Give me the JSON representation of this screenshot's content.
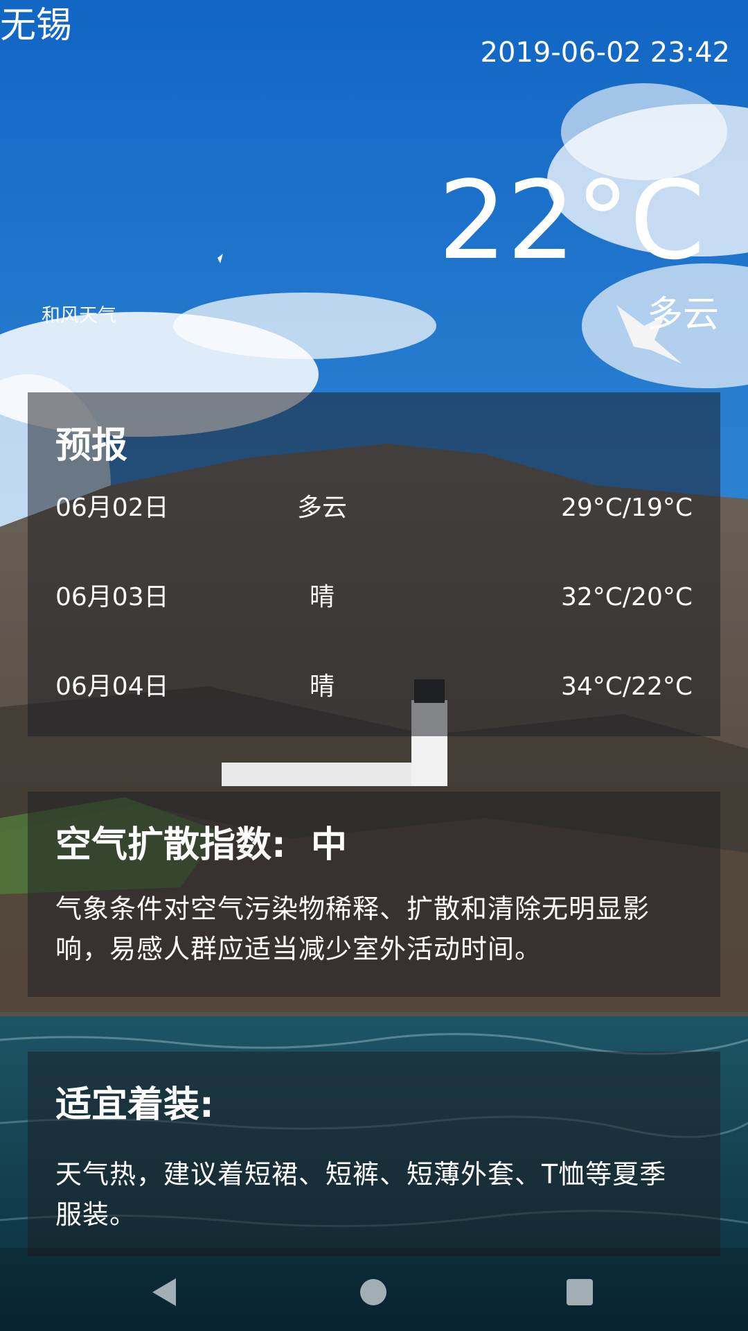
{
  "header": {
    "city": "无锡",
    "datetime": "2019-06-02 23:42",
    "temperature": "22°C",
    "condition": "多云",
    "brand": "和风天气"
  },
  "forecast": {
    "title": "预报",
    "days": [
      {
        "date": "06月02日",
        "weather": "多云",
        "temp_range": "29°C/19°C"
      },
      {
        "date": "06月03日",
        "weather": "晴",
        "temp_range": "32°C/20°C"
      },
      {
        "date": "06月04日",
        "weather": "晴",
        "temp_range": "34°C/22°C"
      }
    ]
  },
  "air": {
    "title": "空气扩散指数:  中",
    "desc": "气象条件对空气污染物稀释、扩散和清除无明显影响，易感人群应适当减少室外活动时间。"
  },
  "clothes": {
    "title": "适宜着装:",
    "desc": "天气热，建议着短裙、短裤、短薄外套、T恤等夏季服装。"
  },
  "navbar": {
    "back_icon": "back-icon",
    "home_icon": "home-icon",
    "recent_icon": "recent-apps-icon"
  },
  "colors": {
    "sky": "#1c6fb6",
    "card": "#1c1e24",
    "sea": "#0e3b4d"
  }
}
